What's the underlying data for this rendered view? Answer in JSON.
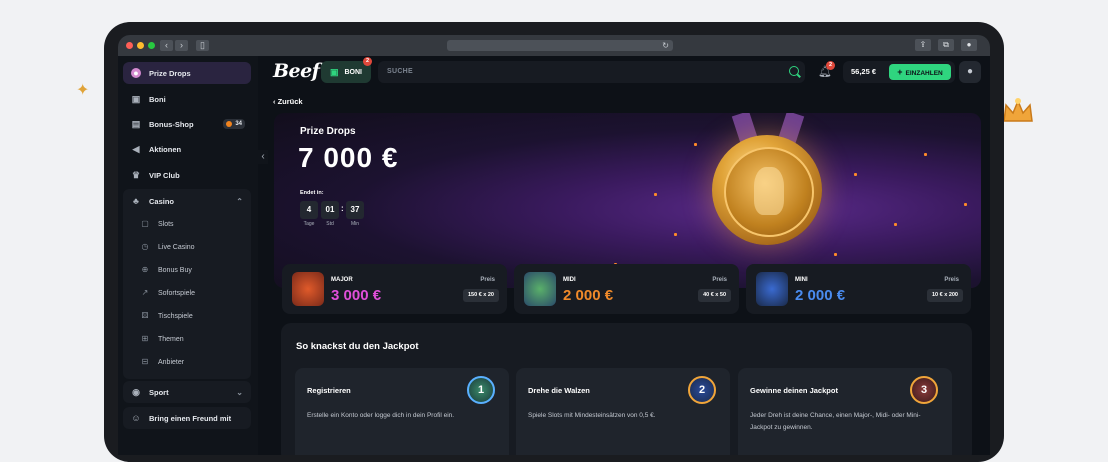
{
  "browser": {
    "reload_icon": "reload-icon"
  },
  "sidebar": {
    "items": [
      {
        "label": "Prize Drops",
        "icon": "prize-drops-avatar-icon"
      },
      {
        "label": "Boni",
        "icon": "gift-icon"
      },
      {
        "label": "Bonus-Shop",
        "icon": "shop-icon",
        "badge": "34"
      },
      {
        "label": "Aktionen",
        "icon": "megaphone-icon"
      },
      {
        "label": "VIP Club",
        "icon": "crown-icon"
      },
      {
        "label": "Casino",
        "icon": "casino-icon"
      }
    ],
    "casino_sub": [
      {
        "label": "Slots",
        "icon": "slots-icon"
      },
      {
        "label": "Live Casino",
        "icon": "live-casino-icon"
      },
      {
        "label": "Bonus Buy",
        "icon": "bonus-buy-icon"
      },
      {
        "label": "Sofortspiele",
        "icon": "instant-games-icon"
      },
      {
        "label": "Tischspiele",
        "icon": "table-games-icon"
      },
      {
        "label": "Themen",
        "icon": "themes-icon"
      },
      {
        "label": "Anbieter",
        "icon": "providers-icon"
      }
    ],
    "sport": "Sport",
    "refer": "Bring einen Freund mit"
  },
  "header": {
    "logo": "Beef",
    "boni_label": "BONI",
    "boni_badge": "2",
    "search_placeholder": "SUCHE",
    "notif_badge": "2",
    "balance": "56,25 €",
    "deposit_label": "EINZAHLEN"
  },
  "back_label": "Zurück",
  "hero": {
    "title": "Prize Drops",
    "amount": "7 000 €",
    "ends_label": "Endet in:",
    "countdown": {
      "days": "4",
      "hours": "01",
      "minutes": "37",
      "days_label": "Tage",
      "hours_label": "Std",
      "minutes_label": "Min"
    }
  },
  "tiers": [
    {
      "name": "MAJOR",
      "amount": "3 000 €",
      "color": "#e04fd9",
      "price_label": "Preis",
      "price": "150 € x 20"
    },
    {
      "name": "MIDI",
      "amount": "2 000 €",
      "color": "#f08a2a",
      "price_label": "Preis",
      "price": "40 € x 50"
    },
    {
      "name": "MINI",
      "amount": "2 000 €",
      "color": "#4a8cf0",
      "price_label": "Preis",
      "price": "10 € x 200"
    }
  ],
  "how": {
    "title": "So knackst du den Jackpot",
    "steps": [
      {
        "title": "Registrieren",
        "num": "1",
        "desc": "Erstelle ein Konto oder logge dich in dein Profil ein."
      },
      {
        "title": "Drehe die Walzen",
        "num": "2",
        "desc": "Spiele Slots mit Mindesteinsätzen von 0,5 €."
      },
      {
        "title": "Gewinne deinen Jackpot",
        "num": "3",
        "desc": "Jeder Dreh ist deine Chance, einen Major-, Midi- oder Mini-Jackpot zu gewinnen."
      }
    ]
  },
  "colors": {
    "accent": "#2fd57f",
    "sidebar_bg": "#10141a",
    "card_bg": "#171b22"
  }
}
